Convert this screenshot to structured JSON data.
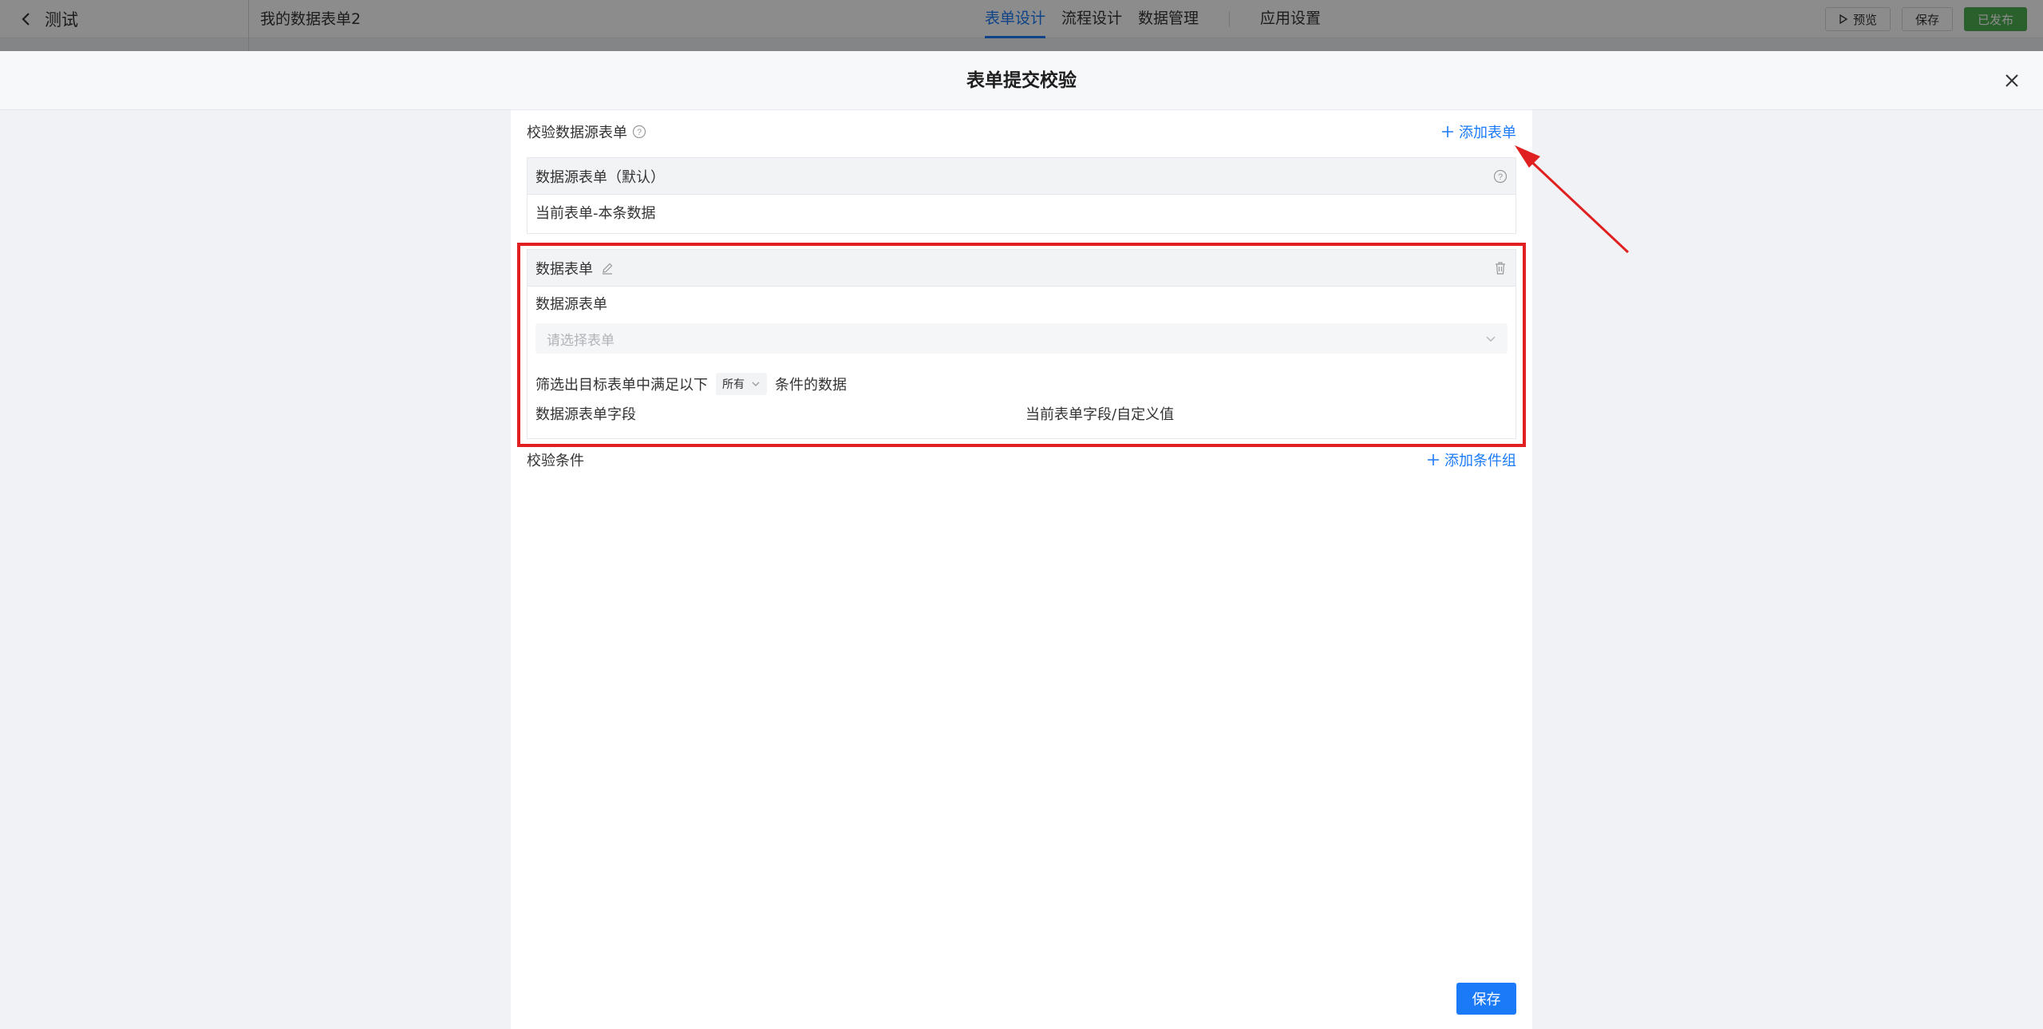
{
  "topbar": {
    "back_label": "测试",
    "form_name": "我的数据表单2",
    "tabs": [
      "表单设计",
      "流程设计",
      "数据管理",
      "应用设置"
    ],
    "preview_label": "预览",
    "save_label": "保存",
    "publish_label": "已发布"
  },
  "modal": {
    "title": "表单提交校验",
    "source_section_label": "校验数据源表单",
    "add_form_label": "添加表单",
    "default_card": {
      "title": "数据源表单（默认）",
      "body": "当前表单-本条数据"
    },
    "data_card": {
      "title": "数据表单",
      "source_label": "数据源表单",
      "select_placeholder": "请选择表单",
      "filter_prefix": "筛选出目标表单中满足以下",
      "filter_mode": "所有",
      "filter_suffix": "条件的数据",
      "col_left": "数据源表单字段",
      "col_right": "当前表单字段/自定义值"
    },
    "condition_label": "校验条件",
    "add_condition_group_label": "添加条件组",
    "save_button": "保存"
  },
  "colors": {
    "accent": "#1a7af8",
    "highlight": "#e02020",
    "published": "#4caf50"
  }
}
